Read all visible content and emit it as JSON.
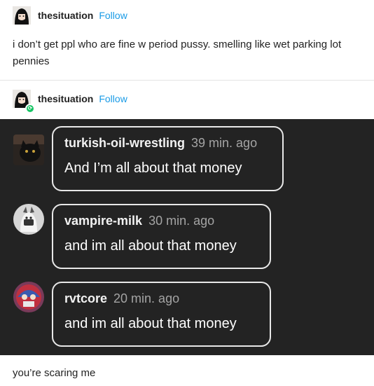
{
  "posts": [
    {
      "username": "thesituation",
      "follow_label": "Follow",
      "text": "i don’t get ppl who are fine w period pussy. smelling like wet parking lot pennies"
    },
    {
      "username": "thesituation",
      "follow_label": "Follow",
      "reblog_icon": "⟳"
    }
  ],
  "screenshot_comments": [
    {
      "username": "turkish-oil-wrestling",
      "time": "39 min. ago",
      "text": "And I’m all about that money"
    },
    {
      "username": "vampire-milk",
      "time": "30 min. ago",
      "text": "and im all about that money"
    },
    {
      "username": "rvtcore",
      "time": "20 min. ago",
      "text": "and im all about that money"
    }
  ],
  "final_text": "you’re scaring me",
  "colors": {
    "follow": "#1a9be6",
    "reblog_badge": "#16c463",
    "panel": "#232323"
  }
}
